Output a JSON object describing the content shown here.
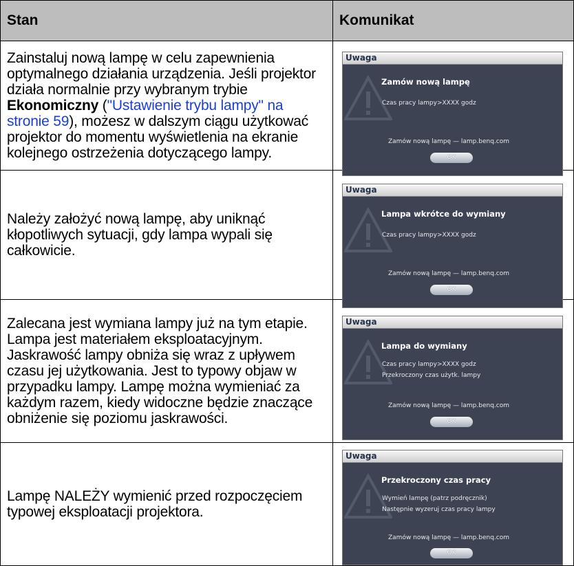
{
  "header": {
    "col1": "Stan",
    "col2": "Komunikat"
  },
  "rows": [
    {
      "text_before": "Zainstaluj nową lampę w celu zapewnienia optymalnego działania urządzenia. Jeśli projektor działa normalnie przy wybranym trybie ",
      "bold": "Ekonomiczny",
      "text_mid": " (",
      "link": "\"Ustawienie trybu lampy\" na stronie 59",
      "text_after": "), możesz w dalszym ciągu użytkować projektor do momentu wyświetlenia na ekranie kolejnego ostrzeżenia dotyczącego lampy.",
      "dialog": {
        "title": "Uwaga",
        "heading": "Zamów nową lampę",
        "line1": "Czas pracy lampy>XXXX godz",
        "line2": "",
        "order": "Zamów nową lampę — lamp.benq.com",
        "ok": "OK"
      }
    },
    {
      "text": "Należy założyć nową lampę, aby uniknąć kłopotliwych sytuacji, gdy lampa wypali się całkowicie.",
      "dialog": {
        "title": "Uwaga",
        "heading": "Lampa wkrótce do wymiany",
        "line1": "Czas pracy lampy>XXXX godz",
        "line2": "",
        "order": "Zamów nową lampę — lamp.benq.com",
        "ok": "OK"
      }
    },
    {
      "text": "Zalecana jest wymiana lampy już na tym etapie. Lampa jest materiałem eksploatacyjnym. Jaskrawość lampy obniża się wraz z upływem czasu jej użytkowania. Jest to typowy objaw w przypadku lampy. Lampę można wymieniać za każdym razem, kiedy widoczne będzie znaczące obniżenie się poziomu jaskrawości.",
      "dialog": {
        "title": "Uwaga",
        "heading": "Lampa do wymiany",
        "line1": "Czas pracy lampy>XXXX godz",
        "line2": "Przekroczony czas użytk. lampy",
        "order": "Zamów nową lampę — lamp.benq.com",
        "ok": "OK"
      }
    },
    {
      "text": "Lampę NALEŻY wymienić przed rozpoczęciem typowej eksploatacji projektora.",
      "dialog": {
        "title": "Uwaga",
        "heading": "Przekroczony czas pracy",
        "line1": "Wymień lampę (patrz podręcznik)",
        "line2": "Następnie wyzeruj czas pracy lampy",
        "order": "Zamów nową lampę — lamp.benq.com",
        "ok": "OK"
      }
    }
  ]
}
